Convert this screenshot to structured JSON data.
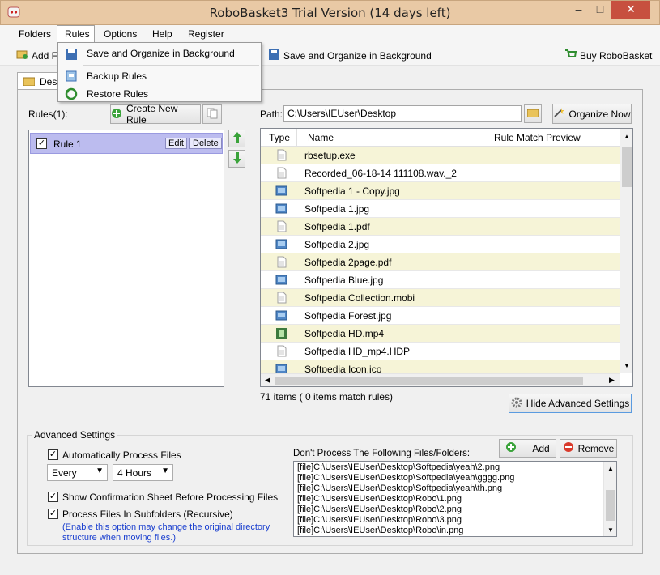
{
  "window": {
    "title": "RoboBasket3 Trial Version (14 days left)",
    "min_glyph": "–",
    "max_glyph": "□",
    "close_glyph": "✕"
  },
  "menubar": [
    "Folders",
    "Rules",
    "Options",
    "Help",
    "Register"
  ],
  "dropdown": {
    "items": [
      "Save and Organize in Background",
      "Backup Rules",
      "Restore Rules"
    ]
  },
  "toolbar": {
    "add_label": "Add F",
    "save_bg_label": "Save and Organize in Background",
    "buy_label": "Buy RoboBasket"
  },
  "tab": {
    "label": "Desk"
  },
  "rules": {
    "header": "Rules(1):",
    "create_label": "Create New Rule",
    "items": [
      {
        "label": "Rule 1",
        "edit": "Edit",
        "delete": "Delete"
      }
    ]
  },
  "path": {
    "label": "Path:",
    "value": "C:\\Users\\IEUser\\Desktop",
    "organize_label": "Organize Now"
  },
  "files": {
    "columns": [
      "Type",
      "Name",
      "Rule Match Preview"
    ],
    "rows": [
      {
        "name": "rbsetup.exe",
        "icon": "doc-icon",
        "highlight": true
      },
      {
        "name": "Recorded_06-18-14 111108.wav._2",
        "icon": "doc-icon",
        "highlight": false
      },
      {
        "name": "Softpedia 1 - Copy.jpg",
        "icon": "image-icon",
        "highlight": true
      },
      {
        "name": "Softpedia 1.jpg",
        "icon": "image-icon",
        "highlight": false
      },
      {
        "name": "Softpedia 1.pdf",
        "icon": "doc-icon",
        "highlight": true
      },
      {
        "name": "Softpedia 2.jpg",
        "icon": "image-icon",
        "highlight": false
      },
      {
        "name": "Softpedia 2page.pdf",
        "icon": "doc-icon",
        "highlight": true
      },
      {
        "name": "Softpedia Blue.jpg",
        "icon": "image-icon",
        "highlight": false
      },
      {
        "name": "Softpedia Collection.mobi",
        "icon": "doc-icon",
        "highlight": true
      },
      {
        "name": "Softpedia Forest.jpg",
        "icon": "image-icon",
        "highlight": false
      },
      {
        "name": "Softpedia HD.mp4",
        "icon": "video-icon",
        "highlight": true
      },
      {
        "name": "Softpedia HD_mp4.HDP",
        "icon": "doc-icon",
        "highlight": false
      },
      {
        "name": "Softpedia Icon.ico",
        "icon": "image-icon",
        "highlight": true
      }
    ],
    "count_text": "71 items ( 0 items match rules)",
    "hide_adv_label": "Hide Advanced Settings"
  },
  "advanced": {
    "title": "Advanced Settings",
    "auto_process": "Automatically Process Files",
    "every_value": "Every",
    "interval_value": "4 Hours",
    "confirm_label": "Show Confirmation Sheet Before Processing Files",
    "subfolders_label": "Process Files In Subfolders (Recursive)",
    "note_line1": "(Enable this option may change the original directory",
    "note_line2": "structure when moving files.)",
    "ignore_label": "Don't Process The Following Files/Folders:",
    "add_label": "Add",
    "remove_label": "Remove",
    "ignore_items": [
      "[file]C:\\Users\\IEUser\\Desktop\\Softpedia\\yeah\\2.png",
      "[file]C:\\Users\\IEUser\\Desktop\\Softpedia\\yeah\\gggg.png",
      "[file]C:\\Users\\IEUser\\Desktop\\Softpedia\\yeah\\th.png",
      "[file]C:\\Users\\IEUser\\Desktop\\Robo\\1.png",
      "[file]C:\\Users\\IEUser\\Desktop\\Robo\\2.png",
      "[file]C:\\Users\\IEUser\\Desktop\\Robo\\3.png",
      "[file]C:\\Users\\IEUser\\Desktop\\Robo\\in.png"
    ]
  },
  "colors": {
    "titlebar": "#e9c9a5",
    "highlight_row": "#f6f4d7",
    "selected_rule": "#bcbcef",
    "close": "#c7503f"
  }
}
